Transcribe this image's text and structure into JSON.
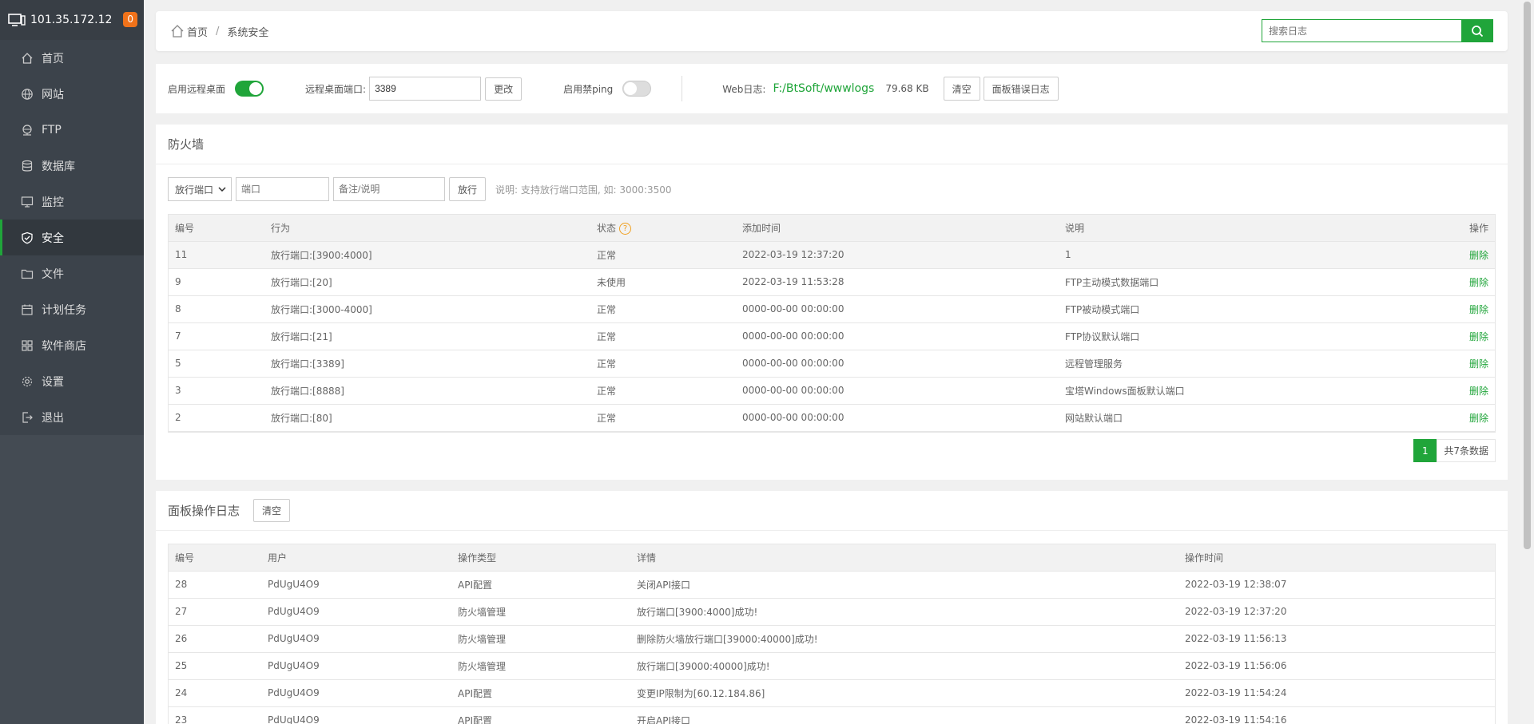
{
  "server": {
    "ip": "101.35.172.12",
    "badge": "0"
  },
  "sidebar": {
    "items": [
      {
        "label": "首页",
        "icon": "home-icon"
      },
      {
        "label": "网站",
        "icon": "globe-icon"
      },
      {
        "label": "FTP",
        "icon": "ftp-icon"
      },
      {
        "label": "数据库",
        "icon": "database-icon"
      },
      {
        "label": "监控",
        "icon": "monitor-icon"
      },
      {
        "label": "安全",
        "icon": "shield-icon",
        "active": true
      },
      {
        "label": "文件",
        "icon": "folder-icon"
      },
      {
        "label": "计划任务",
        "icon": "calendar-icon"
      },
      {
        "label": "软件商店",
        "icon": "apps-icon"
      },
      {
        "label": "设置",
        "icon": "gear-icon"
      },
      {
        "label": "退出",
        "icon": "logout-icon"
      }
    ]
  },
  "breadcrumb": {
    "home": "首页",
    "current": "系统安全"
  },
  "search": {
    "placeholder": "搜索日志"
  },
  "settings": {
    "remote_desktop_label": "启用远程桌面",
    "remote_desktop_on": true,
    "port_label": "远程桌面端口:",
    "port_value": "3389",
    "change_button": "更改",
    "ping_label": "启用禁ping",
    "ping_on": false,
    "weblog_label": "Web日志:",
    "weblog_path": "F:/BtSoft/wwwlogs",
    "weblog_size": "79.68 KB",
    "clear_button": "清空",
    "panel_error_log_button": "面板错误日志"
  },
  "firewall": {
    "title": "防火墙",
    "select_value": "放行端口",
    "port_placeholder": "端口",
    "note_placeholder": "备注/说明",
    "allow_button": "放行",
    "hint": "说明: 支持放行端口范围, 如: 3000:3500",
    "columns": [
      "编号",
      "行为",
      "状态",
      "添加时间",
      "说明",
      "操作"
    ],
    "rows": [
      {
        "id": "11",
        "action": "放行端口:[3900:4000]",
        "status": "正常",
        "time": "2022-03-19 12:37:20",
        "note": "1",
        "op": "删除"
      },
      {
        "id": "9",
        "action": "放行端口:[20]",
        "status": "未使用",
        "time": "2022-03-19 11:53:28",
        "note": "FTP主动模式数据端口",
        "op": "删除"
      },
      {
        "id": "8",
        "action": "放行端口:[3000-4000]",
        "status": "正常",
        "time": "0000-00-00 00:00:00",
        "note": "FTP被动模式端口",
        "op": "删除"
      },
      {
        "id": "7",
        "action": "放行端口:[21]",
        "status": "正常",
        "time": "0000-00-00 00:00:00",
        "note": "FTP协议默认端口",
        "op": "删除"
      },
      {
        "id": "5",
        "action": "放行端口:[3389]",
        "status": "正常",
        "time": "0000-00-00 00:00:00",
        "note": "远程管理服务",
        "op": "删除"
      },
      {
        "id": "3",
        "action": "放行端口:[8888]",
        "status": "正常",
        "time": "0000-00-00 00:00:00",
        "note": "宝塔Windows面板默认端口",
        "op": "删除"
      },
      {
        "id": "2",
        "action": "放行端口:[80]",
        "status": "正常",
        "time": "0000-00-00 00:00:00",
        "note": "网站默认端口",
        "op": "删除"
      }
    ],
    "pager": {
      "current": "1",
      "total": "共7条数据"
    }
  },
  "oplog": {
    "title": "面板操作日志",
    "clear_button": "清空",
    "columns": [
      "编号",
      "用户",
      "操作类型",
      "详情",
      "操作时间"
    ],
    "rows": [
      {
        "id": "28",
        "user": "PdUgU4O9",
        "type": "API配置",
        "detail": "关闭API接口",
        "time": "2022-03-19 12:38:07"
      },
      {
        "id": "27",
        "user": "PdUgU4O9",
        "type": "防火墙管理",
        "detail": "放行端口[3900:4000]成功!",
        "time": "2022-03-19 12:37:20"
      },
      {
        "id": "26",
        "user": "PdUgU4O9",
        "type": "防火墙管理",
        "detail": "删除防火墙放行端口[39000:40000]成功!",
        "time": "2022-03-19 11:56:13"
      },
      {
        "id": "25",
        "user": "PdUgU4O9",
        "type": "防火墙管理",
        "detail": "放行端口[39000:40000]成功!",
        "time": "2022-03-19 11:56:06"
      },
      {
        "id": "24",
        "user": "PdUgU4O9",
        "type": "API配置",
        "detail": "变更IP限制为[60.12.184.86]",
        "time": "2022-03-19 11:54:24"
      },
      {
        "id": "23",
        "user": "PdUgU4O9",
        "type": "API配置",
        "detail": "开启API接口",
        "time": "2022-03-19 11:54:16"
      }
    ]
  },
  "colors": {
    "accent": "#20a53a",
    "sidebar_bg": "#444b53",
    "badge": "#f0721a"
  }
}
